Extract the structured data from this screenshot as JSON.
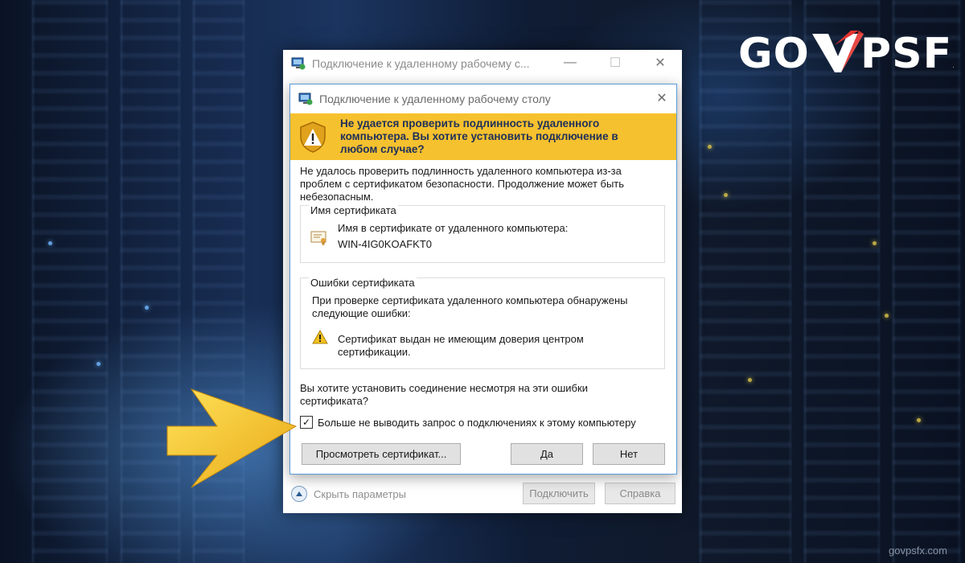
{
  "watermark": "govpsfx.com",
  "logo": {
    "text_left": "GO",
    "text_right": "PSFX"
  },
  "outer_window": {
    "title": "Подключение к удаленному рабочему с...",
    "options_toggle_label": "Скрыть параметры",
    "connect_button": "Подключить",
    "help_button": "Справка"
  },
  "dialog": {
    "title": "Подключение к удаленному рабочему столу",
    "banner_text": "Не удается проверить подлинность удаленного компьютера. Вы хотите установить подключение в любом случае?",
    "intro_text": "Не удалось проверить подлинность удаленного компьютера из-за проблем с сертификатом безопасности. Продолжение может быть небезопасным.",
    "cert_name_group": {
      "title": "Имя сертификата",
      "label": "Имя в сертификате от удаленного компьютера:",
      "value": "WIN-4IG0KOAFKT0"
    },
    "cert_errors_group": {
      "title": "Ошибки сертификата",
      "description": "При проверке сертификата удаленного компьютера обнаружены следующие ошибки:",
      "error_text": "Сертификат выдан не имеющим доверия центром сертификации."
    },
    "question": "Вы хотите установить соединение несмотря на эти ошибки сертификата?",
    "dont_ask_checkbox": {
      "label": "Больше не выводить запрос о подключениях к этому компьютеру",
      "checked": true
    },
    "view_cert_button": "Просмотреть сертификат...",
    "yes_button": "Да",
    "no_button": "Нет"
  },
  "colors": {
    "banner": "#f6c12e",
    "arrow": "#f2c12a",
    "dialog_border": "#5a9bd8"
  }
}
